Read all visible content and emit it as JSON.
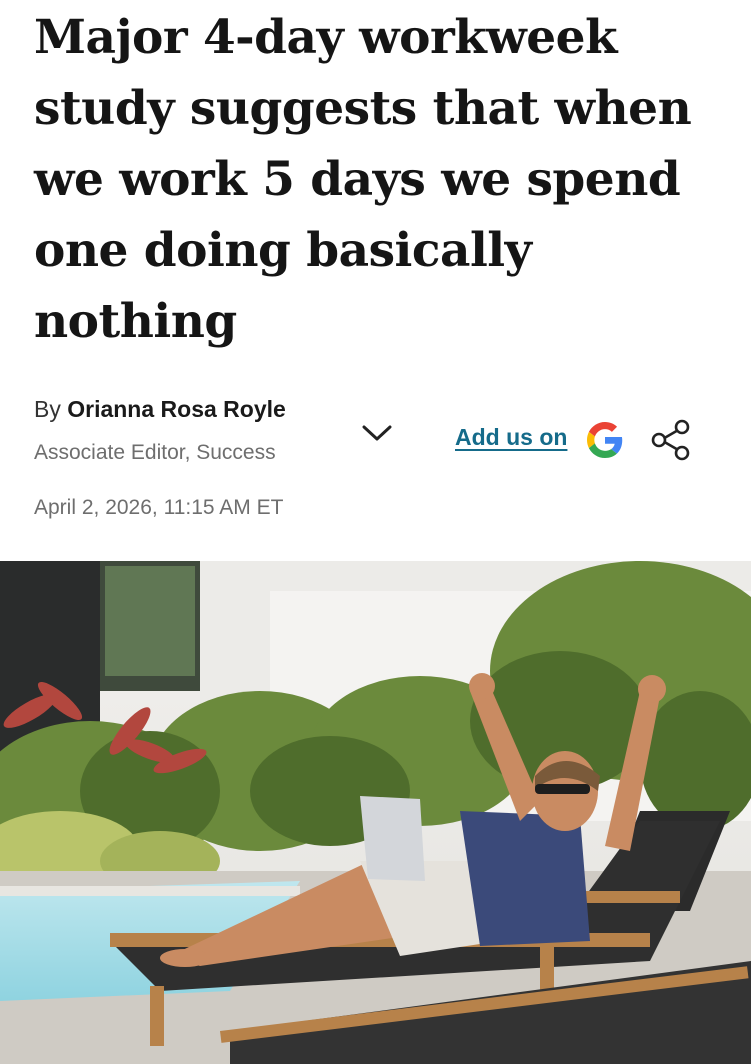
{
  "article": {
    "headline": "Major 4-day workweek study suggests that when we work 5 days we spend one doing basically nothing",
    "byline_prefix": "By",
    "author": "Orianna Rosa Royle",
    "author_role": "Associate Editor, Success",
    "date": "April 2, 2026, 11:15 AM ET"
  },
  "actions": {
    "add_us_label": "Add us on"
  },
  "icons": {
    "expand": "chevron-down-icon",
    "google": "google-g-icon",
    "share": "share-icon"
  },
  "colors": {
    "link": "#156b8a",
    "text_primary": "#151515",
    "text_secondary": "#6e6e6e"
  }
}
